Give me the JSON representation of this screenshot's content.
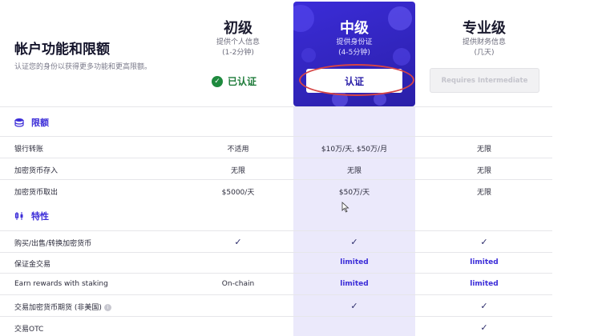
{
  "left": {
    "title": "帐户功能和限额",
    "subtitle": "认证您的身份以获得更多功能和更高限额。"
  },
  "tiers": {
    "basic": {
      "name": "初级",
      "desc1": "提供个人信息",
      "desc2": "(1-2分钟)",
      "status": "已认证"
    },
    "intermediate": {
      "name": "中级",
      "desc1": "提供身份证",
      "desc2": "(4-5分钟)",
      "button": "认证"
    },
    "pro": {
      "name": "专业级",
      "desc1": "提供财务信息",
      "desc2": "(几天)",
      "button": "Requires Intermediate"
    }
  },
  "sections": {
    "limits": {
      "title": "限额",
      "icon": "coins-icon",
      "rows": [
        {
          "label": "银行转账",
          "basic": "不适用",
          "intermediate": "$10万/天, $50万/月",
          "pro": "无限"
        },
        {
          "label": "加密货币存入",
          "basic": "无限",
          "intermediate": "无限",
          "pro": "无限"
        },
        {
          "label": "加密货币取出",
          "basic": "$5000/天",
          "intermediate": "$50万/天",
          "pro": "无限"
        }
      ]
    },
    "features": {
      "title": "特性",
      "icon": "candlestick-icon",
      "rows": [
        {
          "label": "购买/出售/转换加密货币",
          "basic": "✓",
          "intermediate": "✓",
          "pro": "✓"
        },
        {
          "label": "保证金交易",
          "basic": "",
          "intermediate": "limited",
          "pro": "limited"
        },
        {
          "label": "Earn rewards with staking",
          "basic": "On-chain",
          "intermediate": "limited",
          "pro": "limited"
        },
        {
          "label": "交易加密货币期货 (非美国)",
          "basic": "",
          "intermediate": "✓",
          "pro": "✓"
        },
        {
          "label": "交易OTC",
          "basic": "",
          "intermediate": "",
          "pro": "✓"
        }
      ]
    }
  },
  "colors": {
    "accent": "#3b2cd8",
    "verified": "#1e7b3a",
    "highlight": "#d64545"
  }
}
